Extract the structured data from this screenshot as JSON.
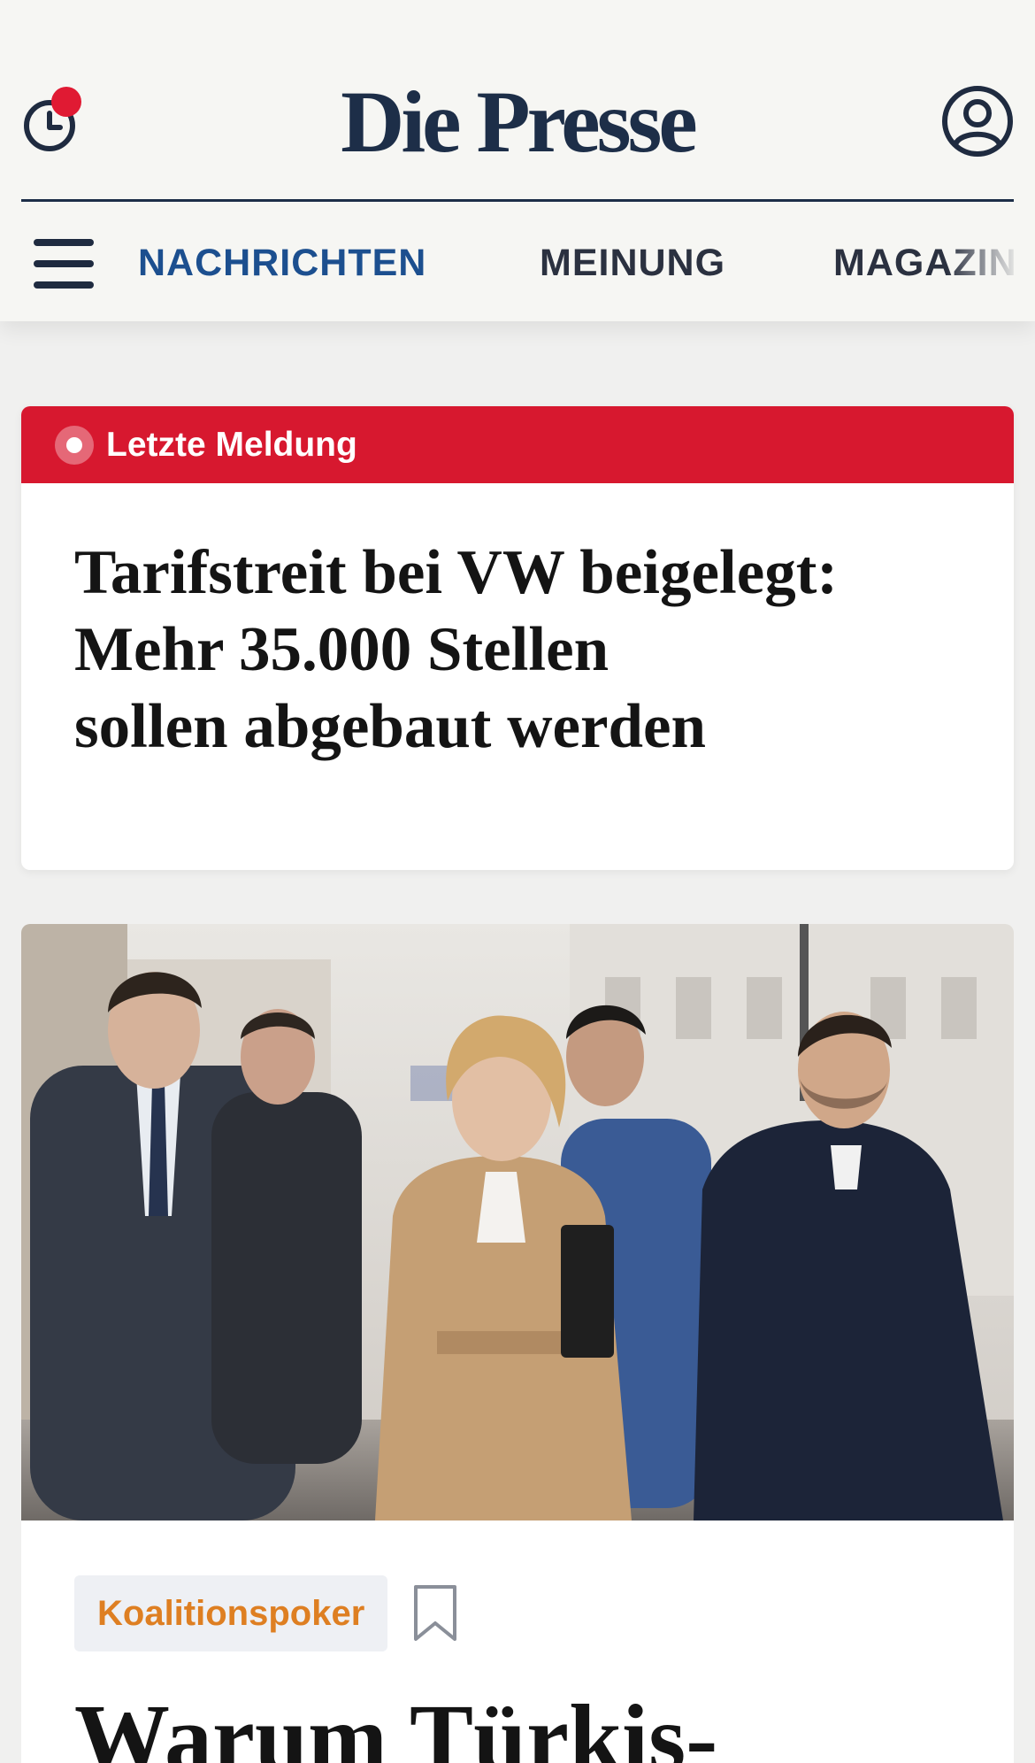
{
  "header": {
    "brand": "Die Presse",
    "history_icon": "clock-icon",
    "has_notification": true,
    "account_icon": "user-circle-icon",
    "brand_color": "#1d2e48"
  },
  "nav": {
    "menu_icon": "hamburger-menu-icon",
    "items": [
      {
        "label": "NACHRICHTEN",
        "active": true
      },
      {
        "label": "MEINUNG",
        "active": false
      },
      {
        "label": "MAGAZIN",
        "active": false
      }
    ],
    "active_color": "#1c4f8f"
  },
  "breaking": {
    "label": "Letzte Meldung",
    "color": "#d7182f",
    "headline_lines": [
      "Tarifstreit bei VW beigelegt:",
      "Mehr 35.000 Stellen",
      "sollen abgebaut werden"
    ]
  },
  "lead_article": {
    "image_icon": "press-photo-politicians-walking",
    "tag": "Koalitionspoker",
    "tag_color": "#de7f22",
    "bookmark_icon": "bookmark-icon",
    "headline_visible": "Warum Türkis-"
  }
}
